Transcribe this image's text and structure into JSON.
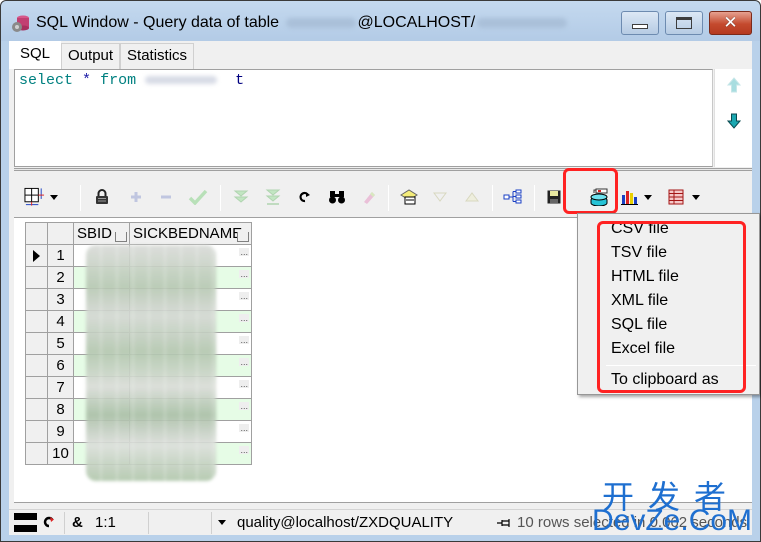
{
  "window": {
    "title_prefix": "SQL Window - Query data of table",
    "title_mid": "@LOCALHOST/",
    "controls": {
      "minimize": "minimize",
      "maximize": "maximize",
      "close": "close"
    }
  },
  "tabs": [
    {
      "label": "SQL",
      "active": true
    },
    {
      "label": "Output",
      "active": false
    },
    {
      "label": "Statistics",
      "active": false
    }
  ],
  "editor": {
    "sql": {
      "kw_select": "select",
      "star": "*",
      "kw_from": "from",
      "alias": "t"
    }
  },
  "toolbar": {
    "buttons": [
      {
        "name": "single-record-view",
        "icon": "grid-icon",
        "enabled": true,
        "has_dropdown": true
      },
      {
        "name": "edit-data",
        "icon": "lock-icon",
        "enabled": true
      },
      {
        "name": "insert-record",
        "icon": "plus-icon",
        "enabled": false
      },
      {
        "name": "delete-record",
        "icon": "minus-icon",
        "enabled": false
      },
      {
        "name": "post-changes",
        "icon": "check-icon",
        "enabled": false
      },
      {
        "name": "fetch-next-page",
        "icon": "fetch-next-icon",
        "enabled": false
      },
      {
        "name": "fetch-last-page",
        "icon": "fetch-last-icon",
        "enabled": false
      },
      {
        "name": "refresh",
        "icon": "refresh-icon",
        "enabled": true
      },
      {
        "name": "find",
        "icon": "binoculars-icon",
        "enabled": true
      },
      {
        "name": "clear-records",
        "icon": "eraser-icon",
        "enabled": false
      },
      {
        "name": "query-by-example",
        "icon": "qbe-icon",
        "enabled": true
      },
      {
        "name": "next-match",
        "icon": "triangle-down-icon",
        "enabled": false
      },
      {
        "name": "previous-match",
        "icon": "triangle-up-icon",
        "enabled": false
      },
      {
        "name": "link-to-parent",
        "icon": "tree-icon",
        "enabled": true
      },
      {
        "name": "save-results",
        "icon": "floppy-icon",
        "enabled": true
      },
      {
        "name": "export-results",
        "icon": "export-db-icon",
        "enabled": true,
        "highlighted": true
      },
      {
        "name": "chart",
        "icon": "bar-chart-icon",
        "enabled": true,
        "has_dropdown": true
      },
      {
        "name": "grid-layout",
        "icon": "table-icon",
        "enabled": true,
        "has_dropdown": true
      }
    ]
  },
  "grid": {
    "columns": [
      "SBID",
      "SICKBEDNAME"
    ],
    "rows": [
      {
        "num": "1",
        "current": true
      },
      {
        "num": "2"
      },
      {
        "num": "3"
      },
      {
        "num": "4"
      },
      {
        "num": "5"
      },
      {
        "num": "6"
      },
      {
        "num": "7"
      },
      {
        "num": "8"
      },
      {
        "num": "9"
      },
      {
        "num": "10"
      }
    ],
    "cell_button": "..."
  },
  "export_menu": {
    "items": [
      "CSV file",
      "TSV file",
      "HTML file",
      "XML file",
      "SQL file",
      "Excel file"
    ],
    "footer_item": "To clipboard as"
  },
  "statusbar": {
    "ampersand": "&",
    "cursor_pos": "1:1",
    "connection": "quality@localhost/ZXDQUALITY",
    "message": "10 rows selected in 0.062 seconds"
  },
  "watermark": {
    "cn": "开发者",
    "en": "DevZe.CoM"
  },
  "colors": {
    "highlight_red": "#ff2222",
    "even_row": "#e6fce6",
    "sql_keyword": "#008080",
    "watermark_blue": "#1e6fd0"
  }
}
